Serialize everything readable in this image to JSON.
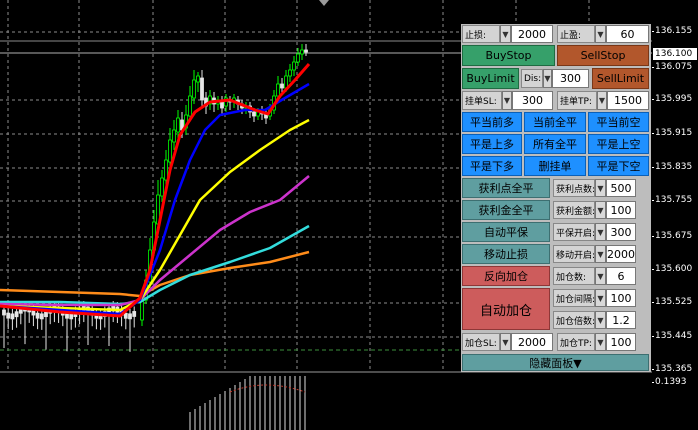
{
  "price_scale": {
    "ticks": [
      "136.155",
      "136.075",
      "135.995",
      "135.915",
      "135.835",
      "135.755",
      "135.675",
      "135.600",
      "135.525",
      "135.445",
      "135.365"
    ],
    "current_price": "136.100",
    "indicator_top": "0.1393"
  },
  "panel": {
    "stop_loss": {
      "label": "止损:",
      "value": "2000"
    },
    "take_profit": {
      "label": "止盈:",
      "value": "60"
    },
    "buy_stop": "BuyStop",
    "sell_stop": "SellStop",
    "buy_limit": "BuyLimit",
    "dis": {
      "label": "Dis:",
      "value": "300"
    },
    "sell_limit": "SellLimit",
    "pending_sl": {
      "label": "挂单SL:",
      "value": "300"
    },
    "pending_tp": {
      "label": "挂单TP:",
      "value": "1500"
    },
    "close_buttons": [
      [
        "平当前多",
        "当前全平",
        "平当前空"
      ],
      [
        "平是上多",
        "所有全平",
        "平是上空"
      ],
      [
        "平是下多",
        "删挂单",
        "平是下空"
      ]
    ],
    "profit_points_close": "获利点全平",
    "profit_points": {
      "label": "获利点数:",
      "value": "500"
    },
    "profit_amount_close": "获利金全平",
    "profit_amount": {
      "label": "获利金额:",
      "value": "100"
    },
    "auto_breakeven": "自动平保",
    "breakeven_start": {
      "label": "平保开启:",
      "value": "300"
    },
    "trailing_stop": "移动止损",
    "trailing_start": {
      "label": "移动开启:",
      "value": "2000"
    },
    "reverse_add": "反向加仓",
    "auto_add": "自动加仓",
    "add_count": {
      "label": "加仓数:",
      "value": "6"
    },
    "add_interval": {
      "label": "加仓间隔:",
      "value": "100"
    },
    "add_multiplier": {
      "label": "加仓倍数:",
      "value": "1.2"
    },
    "add_sl": {
      "label": "加仓SL:",
      "value": "2000"
    },
    "add_tp": {
      "label": "加仓TP:",
      "value": "100"
    },
    "hide_panel": "隐藏面板▼",
    "spinner_glyph": "▼"
  },
  "colors": {
    "ma_red": "#ff0000",
    "ma_blue": "#0000ff",
    "ma_yellow": "#ffff00",
    "ma_magenta": "#cc33cc",
    "ma_cyan": "#33dddd",
    "ma_orange": "#ff8c1a",
    "candle": "#e6e6e6",
    "candle_up": "#00ff00"
  }
}
